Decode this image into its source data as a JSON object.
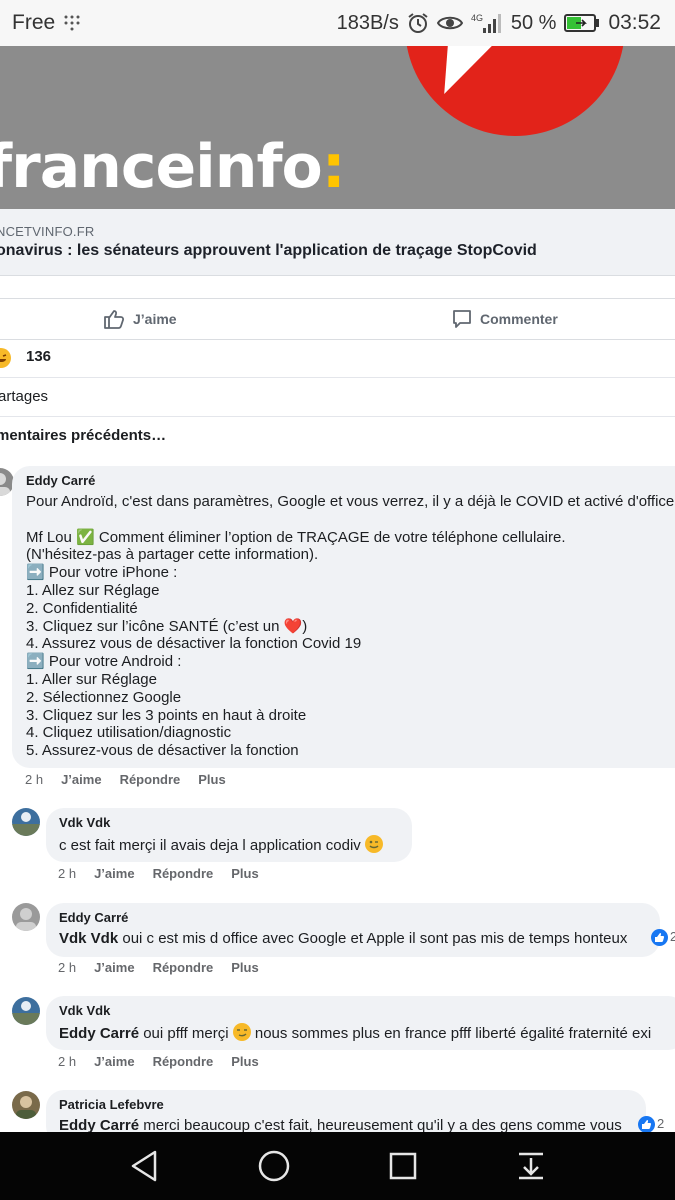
{
  "status_bar": {
    "carrier": "Free",
    "speed": "183B/s",
    "network": "4G",
    "battery": "50 %",
    "time": "03:52"
  },
  "post": {
    "brand_name": "franceinfo",
    "brand_colon": ":",
    "link_domain": "NCETVINFO.FR",
    "link_title": "onavirus : les sénateurs approuvent l'application de traçage StopCovid",
    "like_label": "J’aime",
    "comment_label": "Commenter",
    "reaction_count": "136",
    "shares_label": "artages",
    "previous_comments": "mentaires précédents…"
  },
  "comments": [
    {
      "author": "Eddy Carré",
      "lines": [
        "Pour Androïd, c'est dans paramètres, Google et vous verrez, il y a déjà le COVID et activé d'office",
        "",
        "Mf Lou ✅ Comment éliminer l’option de TRAÇAGE de votre téléphone cellulaire.",
        "(N'hésitez-pas à partager cette information).",
        "➡️ Pour votre iPhone :",
        "1. Allez sur Réglage",
        "2. Confidentialité",
        "3. Cliquez sur l’icône SANTÉ (c’est un ❤️)",
        "4. Assurez vous de désactiver la fonction Covid 19",
        "➡️ Pour votre Android :",
        "1. Aller sur Réglage",
        "2. Sélectionnez Google",
        "3. Cliquez sur les 3 points en haut à droite",
        "4. Cliquez utilisation/diagnostic",
        "5. Assurez-vous de désactiver la fonction"
      ],
      "time": "2 h",
      "like": "J’aime",
      "reply": "Répondre",
      "more": "Plus"
    },
    {
      "author": "Vdk Vdk",
      "text": "c est fait merçi il avais deja l application codiv",
      "time": "2 h",
      "like": "J’aime",
      "reply": "Répondre",
      "more": "Plus"
    },
    {
      "author": "Eddy Carré",
      "mention": "Vdk Vdk",
      "text": " oui c est mis d office avec Google et Apple il sont pas mis de temps honteux",
      "like_count": "2",
      "time": "2 h",
      "like": "J’aime",
      "reply": "Répondre",
      "more": "Plus"
    },
    {
      "author": "Vdk Vdk",
      "mention": "Eddy Carré",
      "text_before": " oui pfff merçi ",
      "text_after": " nous sommes plus en france pfff liberté égalité fraternité exi",
      "time": "2 h",
      "like": "J’aime",
      "reply": "Répondre",
      "more": "Plus"
    },
    {
      "author": "Patricia Lefebvre",
      "mention": "Eddy Carré",
      "text": " merci beaucoup c'est fait, heureusement qu'il y a des gens comme vous",
      "like_count": "2"
    }
  ],
  "colors": {
    "facebook_blue": "#1877f2",
    "bubble_gray": "#f0f2f5",
    "franceinfo_red": "#e2231a",
    "franceinfo_yellow": "#ffc400"
  },
  "icons": [
    "wifi-icon",
    "alarm-icon",
    "eye-icon",
    "signal-icon",
    "battery-icon",
    "thumbs-up-icon",
    "comment-icon",
    "back-icon",
    "home-icon",
    "recents-icon",
    "notification-drawer-icon"
  ]
}
